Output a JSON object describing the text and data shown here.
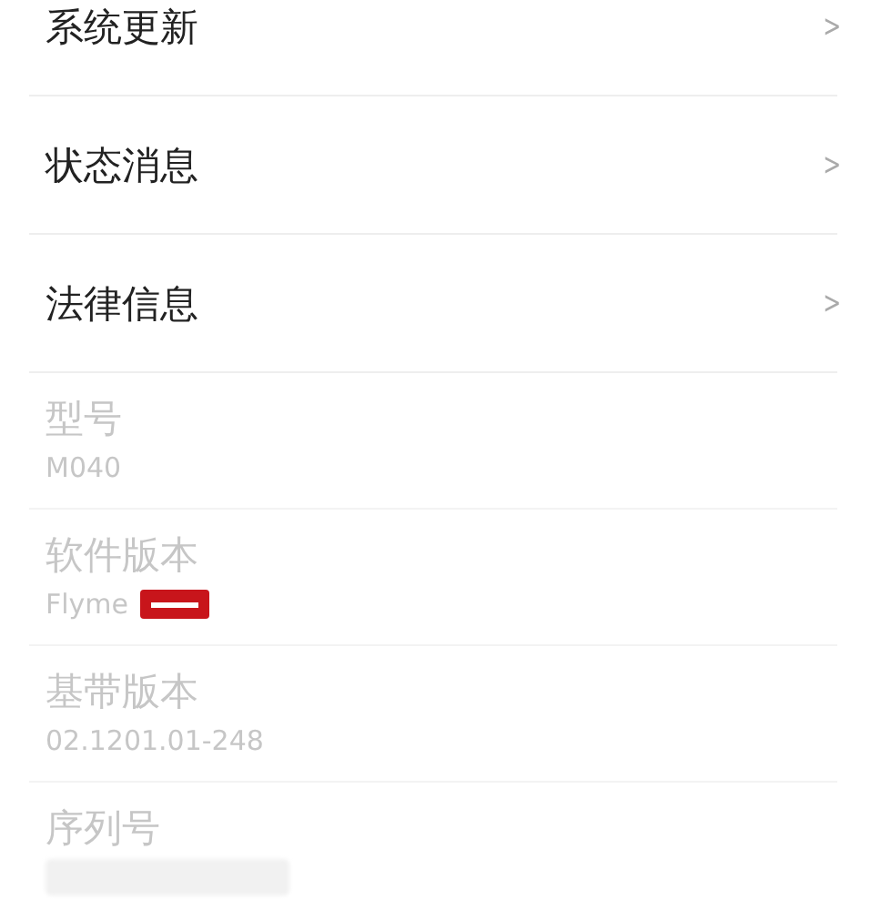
{
  "menu_items": [
    {
      "label": "系统更新",
      "chevron": ">"
    },
    {
      "label": "状态消息",
      "chevron": ">"
    },
    {
      "label": "法律信息",
      "chevron": ">"
    }
  ],
  "info_items": [
    {
      "kind": "plain",
      "label": "型号",
      "value": "M040"
    },
    {
      "kind": "redacted",
      "label": "软件版本",
      "value": "Flyme"
    },
    {
      "kind": "plain",
      "label": "基带版本",
      "value": "02.1201.01-248"
    },
    {
      "kind": "blurred",
      "label": "序列号"
    }
  ]
}
